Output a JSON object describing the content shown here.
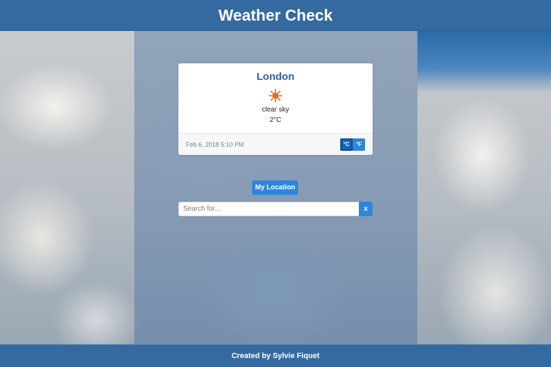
{
  "header": {
    "title": "Weather Check"
  },
  "weather_card": {
    "city": "London",
    "icon": "sun-icon",
    "description": "clear sky",
    "temperature": "2°C",
    "datetime": "Feb 6, 2018 5:10 PM",
    "units": {
      "celsius_label": "°C",
      "fahrenheit_label": "°F",
      "selected": "celsius"
    }
  },
  "controls": {
    "location_button_label": "My Location",
    "search_placeholder": "Search for...",
    "search_value": "",
    "clear_button_label": "x"
  },
  "footer": {
    "credit": "Created by Sylvie Fiquet"
  },
  "colors": {
    "header_bg": "#346aa0",
    "accent": "#2d86dc",
    "city_text": "#2f5f9a",
    "sun": "#e8570f"
  }
}
